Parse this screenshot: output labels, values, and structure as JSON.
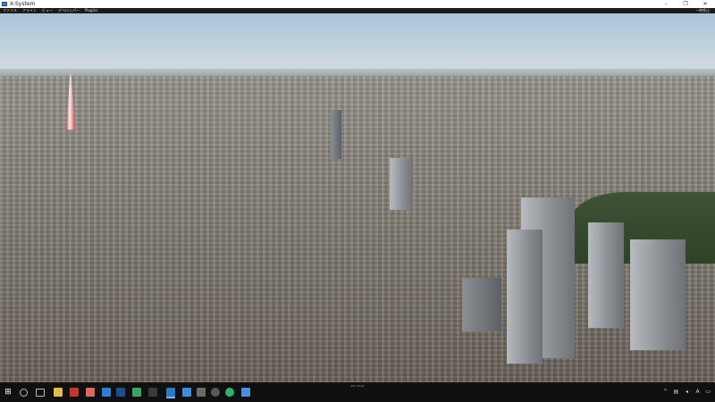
{
  "window": {
    "title": "X-System",
    "minimize_icon": "minimize-icon",
    "maximize_icon": "maximize-icon",
    "close_icon": "close-icon"
  },
  "menu": {
    "items": [
      "ファイル",
      "フライト",
      "ビュー",
      "デベロッパー",
      "Plugins"
    ],
    "right_label": "一時停止"
  },
  "viewport": {
    "description_icon": "simulator-view"
  },
  "taskbar": {
    "hint": "Sim Mode",
    "pinned_icons": [
      "windows-start-icon",
      "search-icon",
      "task-view-icon",
      "explorer-icon",
      "app-icon-red",
      "app-icon-blue",
      "app-icon-green",
      "app-icon-dark",
      "xplane-icon",
      "photos-icon",
      "app-icon-grey",
      "settings-icon",
      "browser-icon",
      "store-icon"
    ],
    "tray_icons": [
      "network-icon",
      "volume-icon",
      "ime-icon",
      "notification-icon"
    ]
  },
  "colors": {
    "titlebar_bg": "#ffffff",
    "menubar_bg": "#1b1b1b",
    "taskbar_bg": "#101010",
    "sky_top": "#a9c4d8",
    "accent_blue": "#3a7bd5"
  }
}
